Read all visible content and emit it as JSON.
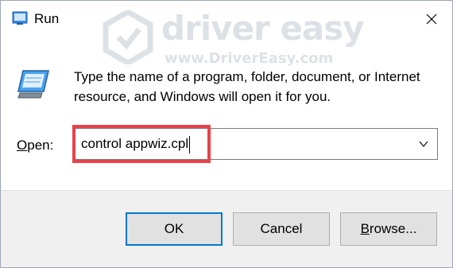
{
  "window": {
    "title": "Run",
    "close_icon": "close-icon"
  },
  "watermark": {
    "brand": "driver easy",
    "url": "www.DriverEasy.com"
  },
  "description": "Type the name of a program, folder, document, or Internet resource, and Windows will open it for you.",
  "open": {
    "label_accel": "O",
    "label_rest": "pen:",
    "value": "control appwiz.cpl",
    "dropdown_icon": "chevron-down-icon"
  },
  "highlight_color": "#e8424a",
  "buttons": {
    "ok": "OK",
    "cancel": "Cancel",
    "browse_accel": "B",
    "browse_rest": "rowse..."
  }
}
